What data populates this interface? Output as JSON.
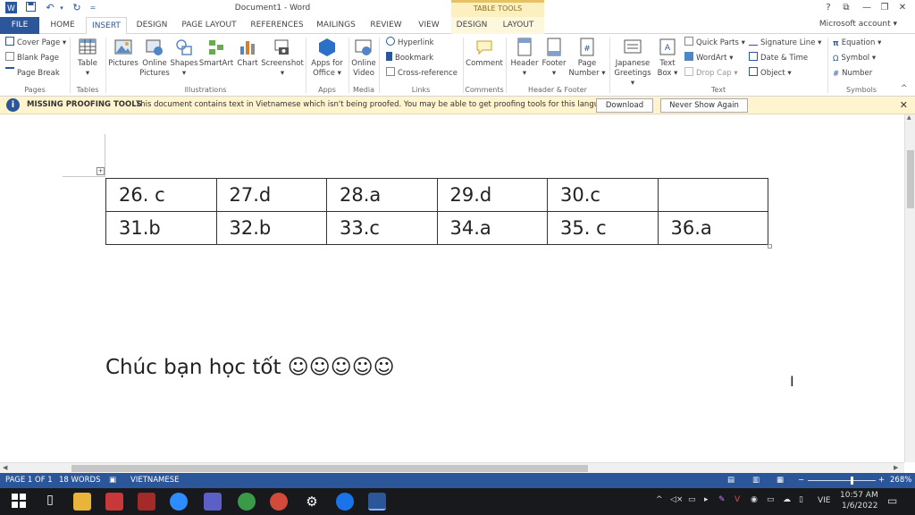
{
  "window": {
    "title": "Document1 - Word",
    "table_tools_label": "TABLE TOOLS",
    "account": "Microsoft account",
    "help": "?"
  },
  "tabs": [
    "FILE",
    "HOME",
    "INSERT",
    "DESIGN",
    "PAGE LAYOUT",
    "REFERENCES",
    "MAILINGS",
    "REVIEW",
    "VIEW",
    "DESIGN",
    "LAYOUT"
  ],
  "ribbon": {
    "pages": {
      "cover_page": "Cover Page",
      "blank_page": "Blank Page",
      "page_break": "Page Break",
      "label": "Pages"
    },
    "tables": {
      "table": "Table",
      "label": "Tables"
    },
    "illustrations": {
      "pictures": "Pictures",
      "online_pictures_1": "Online",
      "online_pictures_2": "Pictures",
      "shapes": "Shapes",
      "smartart": "SmartArt",
      "chart": "Chart",
      "screenshot": "Screenshot",
      "label": "Illustrations"
    },
    "apps": {
      "apps_1": "Apps for",
      "apps_2": "Office",
      "label": "Apps"
    },
    "media": {
      "video_1": "Online",
      "video_2": "Video",
      "label": "Media"
    },
    "links": {
      "hyperlink": "Hyperlink",
      "bookmark": "Bookmark",
      "crossref": "Cross-reference",
      "label": "Links"
    },
    "comments": {
      "comment": "Comment",
      "label": "Comments"
    },
    "header_footer": {
      "header": "Header",
      "footer": "Footer",
      "page_number_1": "Page",
      "page_number_2": "Number",
      "label": "Header & Footer"
    },
    "text": {
      "greet_1": "Japanese",
      "greet_2": "Greetings",
      "textbox_1": "Text",
      "textbox_2": "Box",
      "quick_parts": "Quick Parts",
      "wordart": "WordArt",
      "drop_cap": "Drop Cap",
      "signature": "Signature Line",
      "datetime": "Date & Time",
      "object": "Object",
      "label": "Text"
    },
    "symbols": {
      "equation": "Equation",
      "symbol": "Symbol",
      "number": "Number",
      "label": "Symbols"
    }
  },
  "message_bar": {
    "title": "MISSING PROOFING TOOLS",
    "text": "This document contains text in Vietnamese which isn't being proofed. You may be able to get proofing tools for this language.",
    "download": "Download",
    "never_show": "Never Show Again"
  },
  "document": {
    "table": [
      [
        "26. c",
        "27.d",
        "28.a",
        "29.d",
        "30.c",
        ""
      ],
      [
        "31.b",
        "32.b",
        "33.c",
        "34.a",
        "35. c",
        "36.a"
      ]
    ],
    "closing_text": "Chúc bạn học tốt ☺☺☺☺☺"
  },
  "status": {
    "page": "PAGE 1 OF 1",
    "words": "18 WORDS",
    "language": "VIETNAMESE",
    "zoom": "268%"
  },
  "taskbar": {
    "language": "VIE",
    "time": "10:57 AM",
    "date": "1/6/2022"
  },
  "colors": {
    "word_blue": "#2b579a",
    "message_bar": "#fff4ce",
    "table_tools": "#fdf0c0"
  }
}
